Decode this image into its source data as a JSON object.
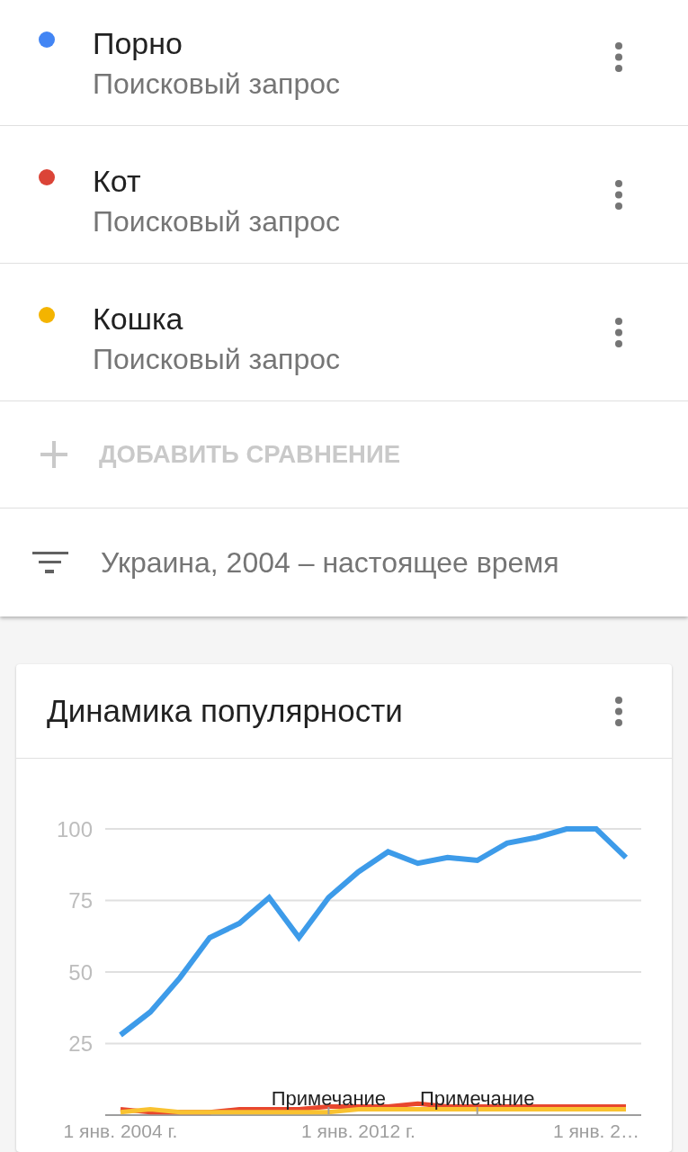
{
  "terms": [
    {
      "name": "Порно",
      "subtitle": "Поисковый запрос",
      "color": "#4285f4"
    },
    {
      "name": "Кот",
      "subtitle": "Поисковый запрос",
      "color": "#db4437"
    },
    {
      "name": "Кошка",
      "subtitle": "Поисковый запрос",
      "color": "#f4b400"
    }
  ],
  "add_comparison": {
    "label": "ДОБАВИТЬ СРАВНЕНИЕ",
    "disabled": true
  },
  "filter": {
    "label": "Украина, 2004 – настоящее время"
  },
  "card": {
    "title": "Динамика популярности",
    "chart_data": {
      "type": "line",
      "categories": [
        "1 янв. 2004 г.",
        null,
        null,
        null,
        null,
        null,
        null,
        null,
        "1 янв. 2012 г.",
        null,
        null,
        null,
        null,
        null,
        null,
        null,
        "1 янв. 2…",
        null
      ],
      "series": [
        {
          "color": "#3d9be9",
          "values": [
            28,
            36,
            48,
            62,
            67,
            76,
            62,
            76,
            85,
            92,
            88,
            90,
            89,
            95,
            97,
            100,
            100,
            90
          ]
        },
        {
          "color": "#e8472e",
          "values": [
            2,
            1,
            1,
            1,
            2,
            2,
            2,
            3,
            3,
            3,
            4,
            3,
            3,
            3,
            3,
            3,
            3,
            3
          ]
        },
        {
          "color": "#f9c230",
          "values": [
            1,
            2,
            1,
            1,
            1,
            1,
            1,
            1,
            2,
            2,
            2,
            2,
            2,
            2,
            2,
            2,
            2,
            2
          ]
        }
      ],
      "ylim": [
        0,
        100
      ],
      "yticks": [
        25,
        50,
        75,
        100
      ],
      "grid": true,
      "annotations": [
        "Примечание",
        "Примечание"
      ]
    }
  }
}
